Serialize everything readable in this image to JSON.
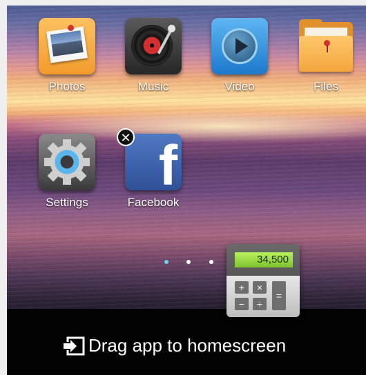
{
  "apps": [
    {
      "id": "photos",
      "label": "Photos",
      "icon": "photos-icon"
    },
    {
      "id": "music",
      "label": "Music",
      "icon": "music-icon"
    },
    {
      "id": "video",
      "label": "Video",
      "icon": "video-icon"
    },
    {
      "id": "files",
      "label": "Files",
      "icon": "files-icon"
    },
    {
      "id": "settings",
      "label": "Settings",
      "icon": "settings-icon"
    },
    {
      "id": "facebook",
      "label": "Facebook",
      "icon": "facebook-icon",
      "removable": true,
      "badge_glyph": "✕",
      "glyph": "f"
    }
  ],
  "pager": {
    "count": 3,
    "active_index": 0,
    "active_color": "#6ed3f2"
  },
  "dragging_app": {
    "name": "Calculator",
    "icon": "calculator-icon",
    "display_value": "34,500",
    "keys": [
      "+",
      "×",
      "−",
      "÷",
      "="
    ]
  },
  "drop_bar": {
    "label": "Drag app to homescreen",
    "icon": "drag-to-homescreen-icon"
  }
}
